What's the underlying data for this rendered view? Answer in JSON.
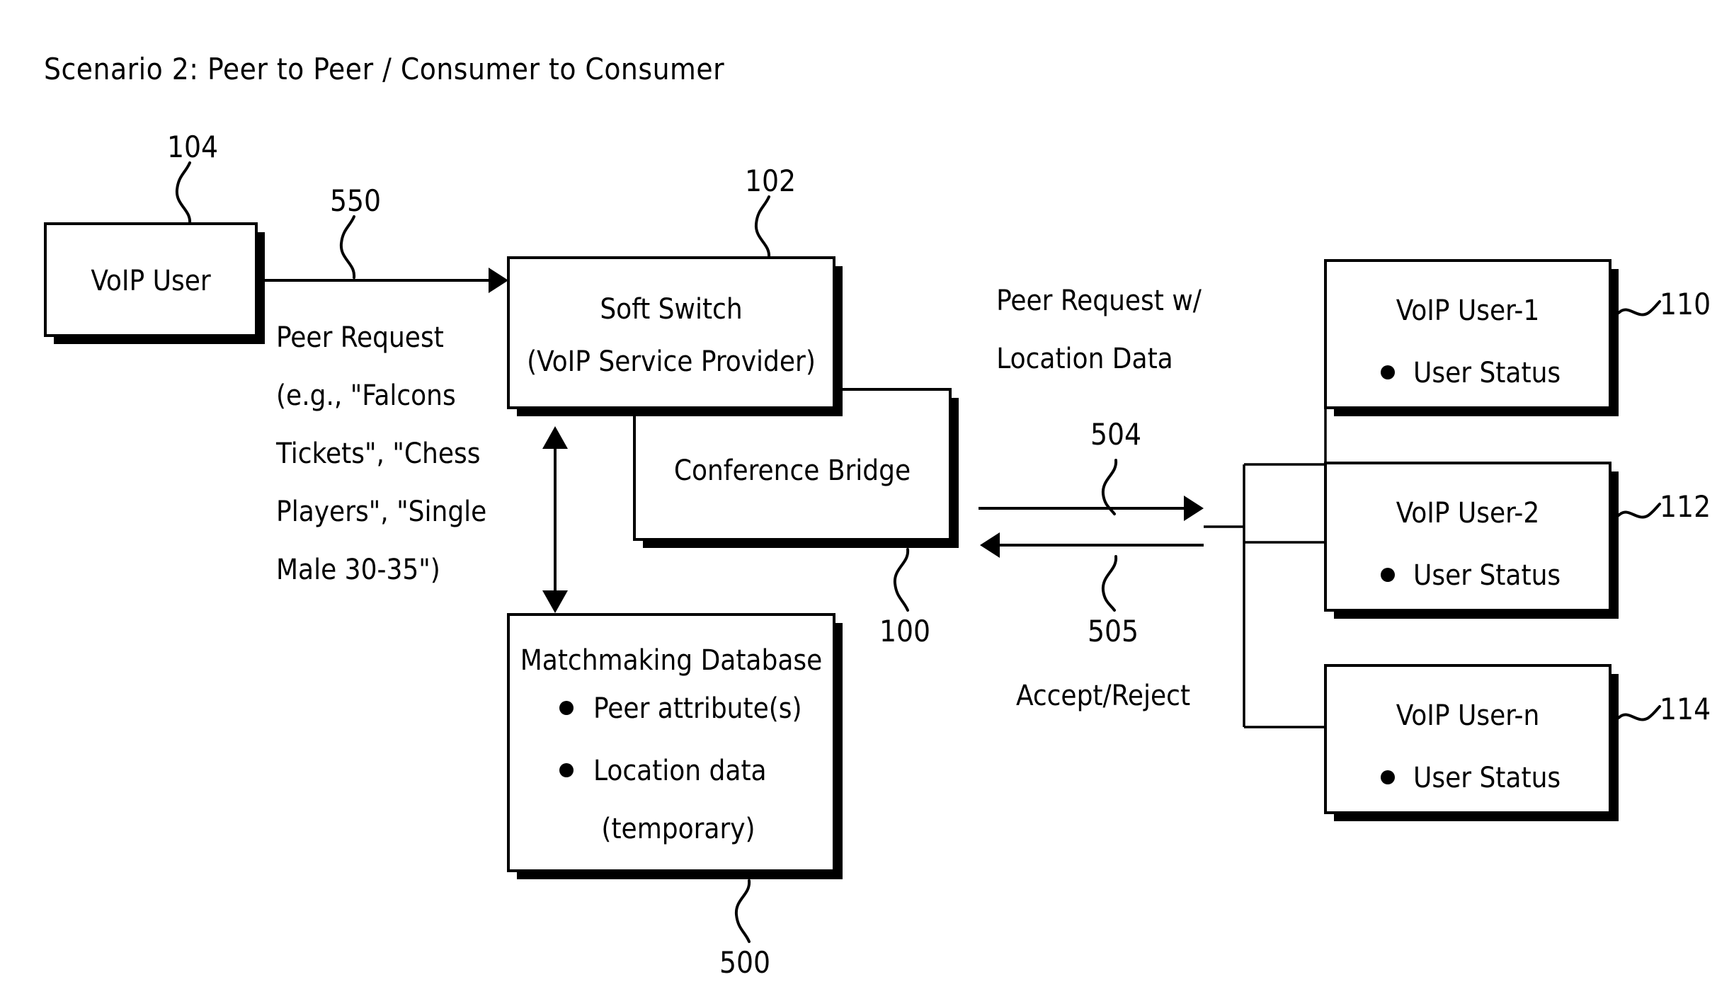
{
  "figure": {
    "title": "Scenario 2: Peer to Peer / Consumer to Consumer"
  },
  "boxes": {
    "voip_user": {
      "label": "VoIP User",
      "numeral": "104"
    },
    "soft_switch": {
      "line1": "Soft Switch",
      "line2": "(VoIP Service Provider)",
      "numeral": "102"
    },
    "conference_bridge": {
      "label": "Conference Bridge",
      "numeral": "100"
    },
    "matchmaking_db": {
      "title": "Matchmaking Database",
      "bullet1": "Peer attribute(s)",
      "bullet2": "Location data",
      "bullet2_cont": "(temporary)",
      "numeral": "500"
    },
    "peers": [
      {
        "label": "VoIP User-1",
        "status": "User Status",
        "numeral": "110"
      },
      {
        "label": "VoIP User-2",
        "status": "User Status",
        "numeral": "112"
      },
      {
        "label": "VoIP User-n",
        "status": "User Status",
        "numeral": "114"
      }
    ]
  },
  "flows": {
    "peer_request": {
      "numeral": "550",
      "caption_lines": [
        "Peer Request",
        "(e.g., \"Falcons",
        "Tickets\", \"Chess",
        "Players\", \"Single",
        "Male 30-35\")"
      ]
    },
    "peer_request_location": {
      "caption_line1": "Peer Request w/",
      "caption_line2": "Location Data",
      "numeral": "504"
    },
    "accept_reject": {
      "numeral": "505",
      "caption": "Accept/Reject"
    }
  },
  "colors": {
    "ink": "#000000",
    "paper": "#ffffff"
  }
}
